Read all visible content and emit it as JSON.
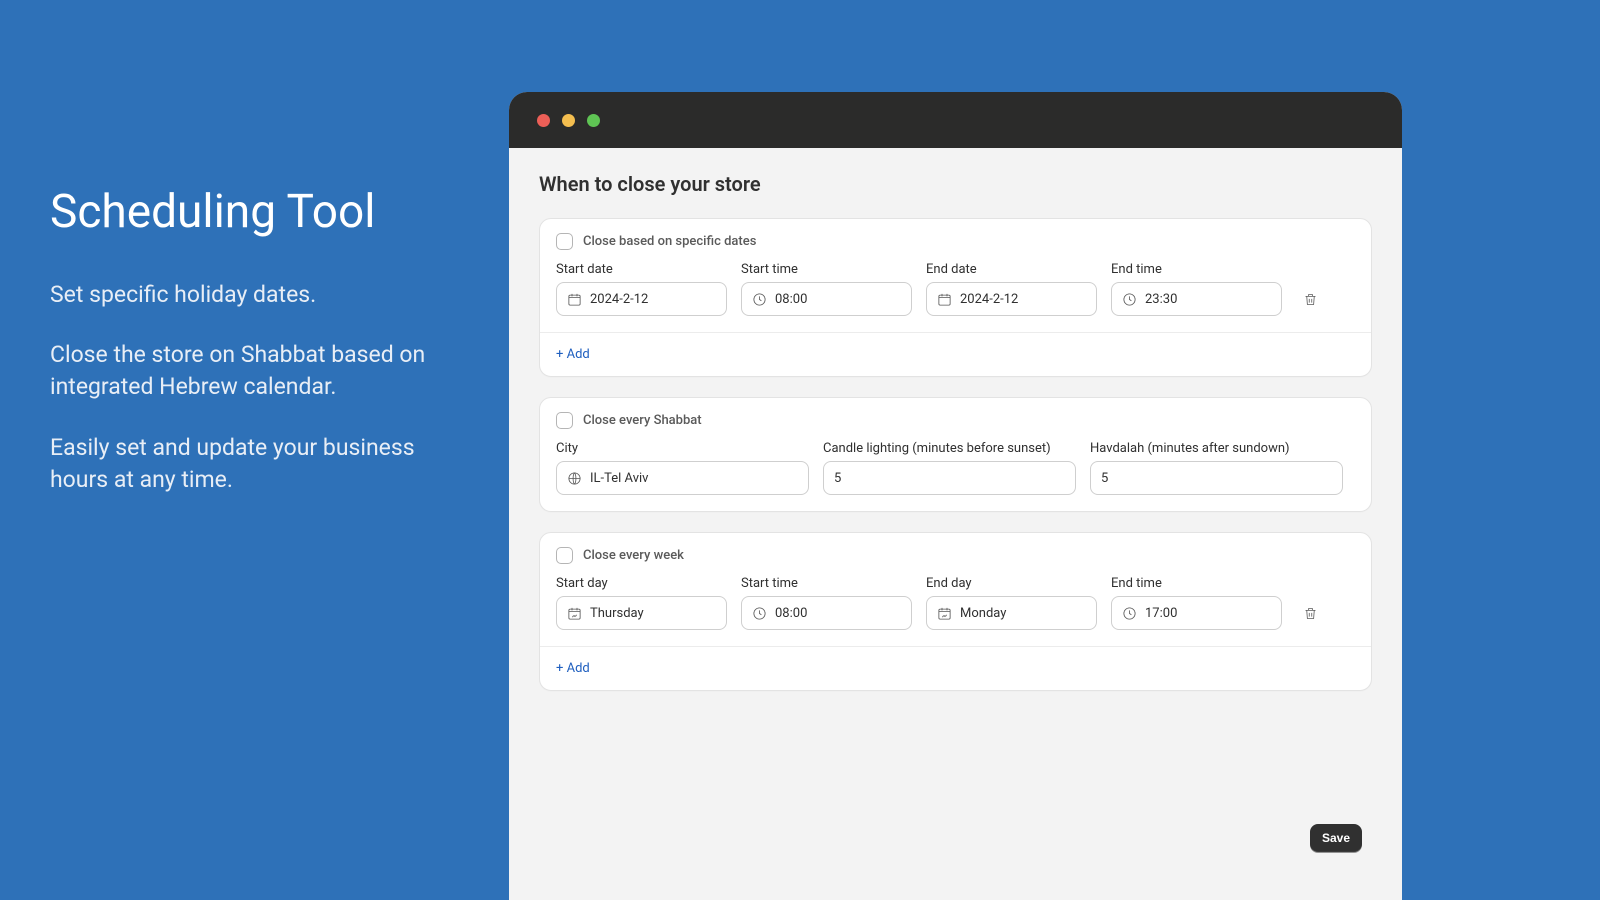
{
  "marketing": {
    "title": "Scheduling Tool",
    "p1": "Set specific holiday dates.",
    "p2": "Close the store on Shabbat based on integrated Hebrew calendar.",
    "p3": "Easily set and update your business hours at any time."
  },
  "page": {
    "title": "When to close your store",
    "save": "Save",
    "add": "+ Add"
  },
  "specific": {
    "checkbox_label": "Close based on specific dates",
    "start_date_label": "Start date",
    "start_date": "2024-2-12",
    "start_time_label": "Start time",
    "start_time": "08:00",
    "end_date_label": "End date",
    "end_date": "2024-2-12",
    "end_time_label": "End time",
    "end_time": "23:30"
  },
  "shabbat": {
    "checkbox_label": "Close every Shabbat",
    "city_label": "City",
    "city": "IL-Tel Aviv",
    "candle_label": "Candle lighting (minutes before sunset)",
    "candle": "5",
    "havdalah_label": "Havdalah (minutes after sundown)",
    "havdalah": "5"
  },
  "weekly": {
    "checkbox_label": "Close every week",
    "start_day_label": "Start day",
    "start_day": "Thursday",
    "start_time_label": "Start time",
    "start_time": "08:00",
    "end_day_label": "End day",
    "end_day": "Monday",
    "end_time_label": "End time",
    "end_time": "17:00"
  }
}
